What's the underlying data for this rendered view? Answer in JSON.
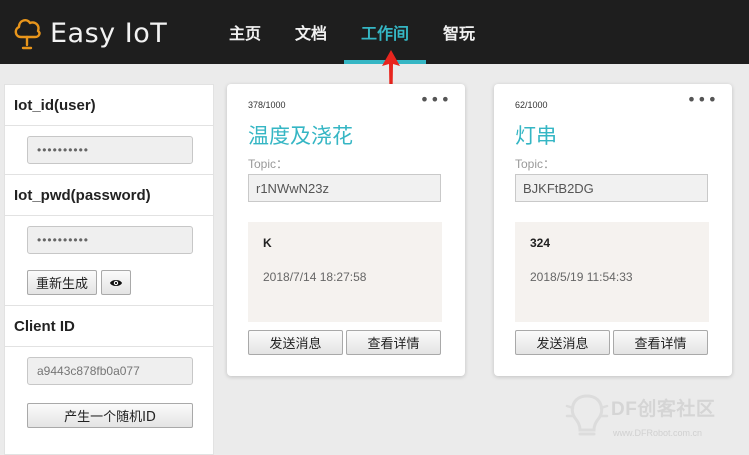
{
  "header": {
    "brand": "Easy IoT",
    "nav": [
      "主页",
      "文档",
      "工作间",
      "智玩"
    ],
    "active_index": 2
  },
  "sidebar": {
    "user_label": "Iot_id(user)",
    "user_value": "••••••••••",
    "pwd_label": "Iot_pwd(password)",
    "pwd_value": "••••••••••",
    "regenerate_label": "重新生成",
    "client_label": "Client ID",
    "client_placeholder": "a9443c878fb0a077",
    "random_id_label": "产生一个随机ID"
  },
  "cards": [
    {
      "quota": "378/1000",
      "title": "温度及浇花",
      "topic_label": "Topic：",
      "topic": "r1NWwN23z",
      "message": "K",
      "time": "2018/7/14 18:27:58",
      "send_label": "发送消息",
      "detail_label": "查看详情"
    },
    {
      "quota": "62/1000",
      "title": "灯串",
      "topic_label": "Topic：",
      "topic": "BJKFtB2DG",
      "message": "324",
      "time": "2018/5/19 11:54:33",
      "send_label": "发送消息",
      "detail_label": "查看详情"
    }
  ],
  "watermark": {
    "name": "DF创客社区",
    "url": "www.DFRobot.com.cn"
  },
  "icons": {
    "brand": "cloud-bulb-icon",
    "more": "more-dots-icon",
    "eye": "eye-icon"
  },
  "colors": {
    "accent": "#35b6c4",
    "header_bg": "#1e1e1e",
    "annotation": "#e8251e"
  }
}
